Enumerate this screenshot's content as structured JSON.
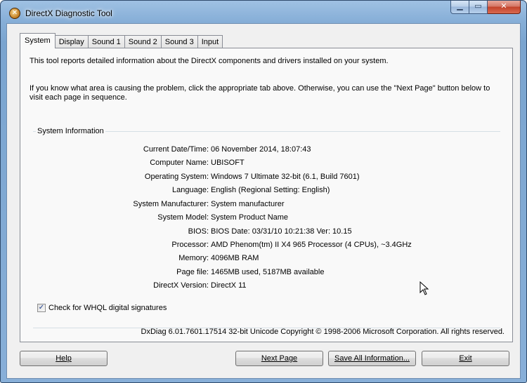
{
  "window": {
    "title": "DirectX Diagnostic Tool",
    "caption_buttons": {
      "minimize": "▁",
      "maximize": "▭",
      "close": "✕"
    },
    "app_icon": "directx-icon"
  },
  "tabs": [
    {
      "label": "System",
      "active": true
    },
    {
      "label": "Display",
      "active": false
    },
    {
      "label": "Sound 1",
      "active": false
    },
    {
      "label": "Sound 2",
      "active": false
    },
    {
      "label": "Sound 3",
      "active": false
    },
    {
      "label": "Input",
      "active": false
    }
  ],
  "intro": {
    "line1": "This tool reports detailed information about the DirectX components and drivers installed on your system.",
    "line2": "If you know what area is causing the problem, click the appropriate tab above.  Otherwise, you can use the \"Next Page\" button below to visit each page in sequence."
  },
  "system_info": {
    "title": "System Information",
    "rows": [
      {
        "label": "Current Date/Time:",
        "value": "06 November 2014, 18:07:43"
      },
      {
        "label": "Computer Name:",
        "value": "UBISOFT"
      },
      {
        "label": "Operating System:",
        "value": "Windows 7 Ultimate 32-bit (6.1, Build 7601)"
      },
      {
        "label": "Language:",
        "value": "English (Regional Setting: English)"
      },
      {
        "label": "System Manufacturer:",
        "value": "System manufacturer"
      },
      {
        "label": "System Model:",
        "value": "System Product Name"
      },
      {
        "label": "BIOS:",
        "value": "BIOS Date: 03/31/10 10:21:38 Ver: 10.15"
      },
      {
        "label": "Processor:",
        "value": "AMD Phenom(tm) II X4 965 Processor (4 CPUs), ~3.4GHz"
      },
      {
        "label": "Memory:",
        "value": "4096MB RAM"
      },
      {
        "label": "Page file:",
        "value": "1465MB used, 5187MB available"
      },
      {
        "label": "DirectX Version:",
        "value": "DirectX 11"
      }
    ]
  },
  "whql": {
    "label": "Check for WHQL digital signatures",
    "checked": true,
    "check_glyph": "✓"
  },
  "footer": "DxDiag 6.01.7601.17514 32-bit Unicode  Copyright © 1998-2006 Microsoft Corporation.  All rights reserved.",
  "buttons": {
    "help": "Help",
    "next_page": "Next Page",
    "save_all": "Save All Information...",
    "exit": "Exit"
  }
}
